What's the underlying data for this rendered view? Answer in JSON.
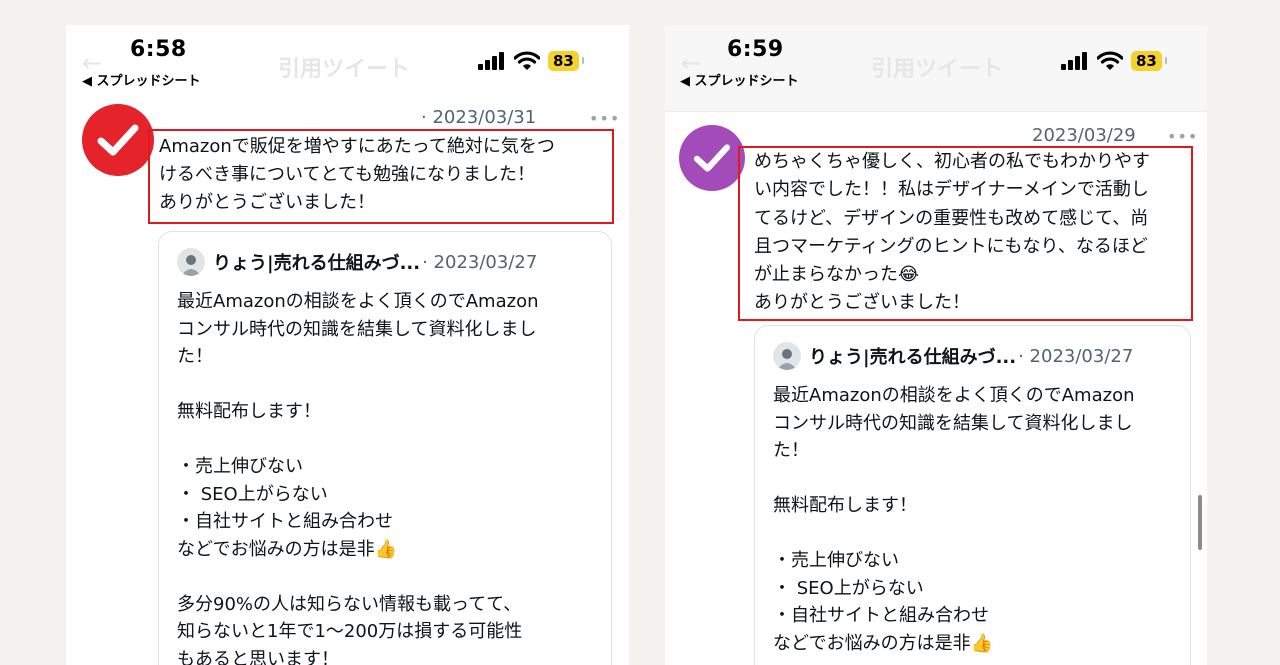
{
  "screens": [
    {
      "status": {
        "time": "6:58",
        "back_app": "◀ スプレッドシート",
        "battery": "83"
      },
      "ghost_title": "引用ツイート",
      "tweet": {
        "date": "· 2023/03/31",
        "more": "•••",
        "text": "Amazonで販促を増やすにあたって絶対に気をつ\nけるべき事についてとても勉強になりました！\nありがとうございました！",
        "badge_color": "#e4232b"
      },
      "quote": {
        "author": "りょう|売れる仕組みづ...",
        "date": "· 2023/03/27",
        "body": "最近Amazonの相談をよく頂くのでAmazon\nコンサル時代の知識を結集して資料化しまし\nた！\n\n無料配布します！\n\n・売上伸びない\n・ SEO上がらない\n・自社サイトと組み合わせ\nなどでお悩みの方は是非👍\n\n多分90%の人は知らない情報も載ってて、\n知らないと1年で1〜200万は損する可能性\nもあると思います！"
      }
    },
    {
      "status": {
        "time": "6:59",
        "back_app": "◀ スプレッドシート",
        "battery": "83"
      },
      "ghost_title": "引用ツイート",
      "tweet": {
        "date": "2023/03/29",
        "more": "•••",
        "text": "めちゃくちゃ優しく、初心者の私でもわかりやす\nい内容でした！！私はデザイナーメインで活動し\nてるけど、デザインの重要性も改めて感じて、尚\n且つマーケティングのヒントにもなり、なるほど\nが止まらなかった😂\nありがとうございました！",
        "badge_color": "#a34bb8"
      },
      "quote": {
        "author": "りょう|売れる仕組みづ...",
        "date": "· 2023/03/27",
        "body": "最近Amazonの相談をよく頂くのでAmazon\nコンサル時代の知識を結集して資料化しまし\nた！\n\n無料配布します！\n\n・売上伸びない\n・ SEO上がらない\n・自社サイトと組み合わせ\nなどでお悩みの方は是非👍"
      }
    }
  ]
}
